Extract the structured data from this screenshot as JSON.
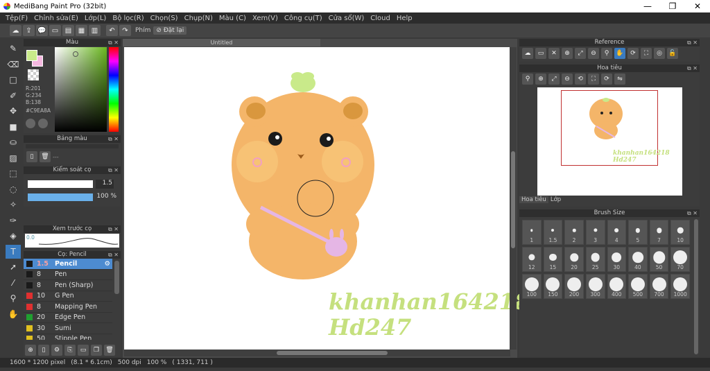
{
  "window": {
    "title": "MediBang Paint Pro (32bit)",
    "minimize": "—",
    "maximize": "❐",
    "close": "✕"
  },
  "menu": [
    "Tệp(F)",
    "Chỉnh sửa(E)",
    "Lớp(L)",
    "Bộ lọc(R)",
    "Chọn(S)",
    "Chụp(N)",
    "Màu (C)",
    "Xem(V)",
    "Công cụ(T)",
    "Cửa sổ(W)",
    "Cloud",
    "Help"
  ],
  "toolbar": {
    "phim_label": "Phím",
    "reset_label": "Đặt lại"
  },
  "color_panel": {
    "title": "Màu",
    "r": "R:201",
    "g": "G:234",
    "b": "B:138",
    "hex": "#C9EA8A",
    "primary": "#C9EA8A",
    "secondary": "#F5B8E0"
  },
  "palette_panel": {
    "title": "Bảng màu",
    "dots": "---"
  },
  "brush_control": {
    "title": "Kiểm soát cọ",
    "size": "1.5",
    "opacity": "100 %"
  },
  "preview_panel": {
    "title": "Xem trước cọ",
    "value": "0.0"
  },
  "brush_panel": {
    "title": "Cọ: Pencil",
    "items": [
      {
        "size": "1.5",
        "name": "Pencil",
        "color": "#1a1a1a",
        "selected": true
      },
      {
        "size": "8",
        "name": "Pen",
        "color": "#1a1a1a"
      },
      {
        "size": "8",
        "name": "Pen (Sharp)",
        "color": "#1a1a1a"
      },
      {
        "size": "10",
        "name": "G Pen",
        "color": "#e03030"
      },
      {
        "size": "8",
        "name": "Mapping Pen",
        "color": "#e03030"
      },
      {
        "size": "20",
        "name": "Edge Pen",
        "color": "#20a030"
      },
      {
        "size": "30",
        "name": "Sumi",
        "color": "#e0c020"
      },
      {
        "size": "50",
        "name": "Stipple Pen",
        "color": "#e0c020"
      }
    ]
  },
  "canvas": {
    "tab": "Untitled",
    "watermark_line1": "khanhan164218",
    "watermark_line2": "Hd247"
  },
  "reference_panel": {
    "title": "Reference"
  },
  "navigator_panel": {
    "title": "Hoa tiêu",
    "tab1": "Hoa tiêu",
    "tab2": "Lớp",
    "watermark_line1": "khanhan164218",
    "watermark_line2": "Hd247"
  },
  "brush_size_panel": {
    "title": "Brush Size",
    "sizes": [
      "1",
      "1.5",
      "2",
      "3",
      "4",
      "5",
      "7",
      "10",
      "12",
      "15",
      "20",
      "25",
      "30",
      "40",
      "50",
      "70",
      "100",
      "150",
      "200",
      "300",
      "400",
      "500",
      "700",
      "1000"
    ]
  },
  "status": {
    "pixels": "1600 * 1200 pixel",
    "cm": "(8.1 * 6.1cm)",
    "dpi": "500 dpi",
    "zoom": "100 %",
    "coords": "( 1331, 711 )"
  }
}
